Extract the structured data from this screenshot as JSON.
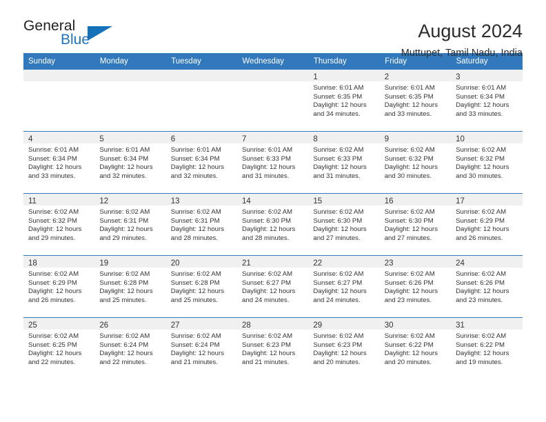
{
  "brand": {
    "name_top": "General",
    "name_bottom": "Blue",
    "accent_color": "#1572b9",
    "triangle_icon": "triangle-icon"
  },
  "header": {
    "month_title": "August 2024",
    "location": "Muttupet, Tamil Nadu, India"
  },
  "calendar": {
    "header_bg": "#3179bc",
    "daynum_band_bg": "#f0f0f0",
    "weekdays": [
      "Sunday",
      "Monday",
      "Tuesday",
      "Wednesday",
      "Thursday",
      "Friday",
      "Saturday"
    ],
    "weeks": [
      [
        {
          "day": "",
          "lines": []
        },
        {
          "day": "",
          "lines": []
        },
        {
          "day": "",
          "lines": []
        },
        {
          "day": "",
          "lines": []
        },
        {
          "day": "1",
          "lines": [
            "Sunrise: 6:01 AM",
            "Sunset: 6:35 PM",
            "Daylight: 12 hours",
            "and 34 minutes."
          ]
        },
        {
          "day": "2",
          "lines": [
            "Sunrise: 6:01 AM",
            "Sunset: 6:35 PM",
            "Daylight: 12 hours",
            "and 33 minutes."
          ]
        },
        {
          "day": "3",
          "lines": [
            "Sunrise: 6:01 AM",
            "Sunset: 6:34 PM",
            "Daylight: 12 hours",
            "and 33 minutes."
          ]
        }
      ],
      [
        {
          "day": "4",
          "lines": [
            "Sunrise: 6:01 AM",
            "Sunset: 6:34 PM",
            "Daylight: 12 hours",
            "and 33 minutes."
          ]
        },
        {
          "day": "5",
          "lines": [
            "Sunrise: 6:01 AM",
            "Sunset: 6:34 PM",
            "Daylight: 12 hours",
            "and 32 minutes."
          ]
        },
        {
          "day": "6",
          "lines": [
            "Sunrise: 6:01 AM",
            "Sunset: 6:34 PM",
            "Daylight: 12 hours",
            "and 32 minutes."
          ]
        },
        {
          "day": "7",
          "lines": [
            "Sunrise: 6:01 AM",
            "Sunset: 6:33 PM",
            "Daylight: 12 hours",
            "and 31 minutes."
          ]
        },
        {
          "day": "8",
          "lines": [
            "Sunrise: 6:02 AM",
            "Sunset: 6:33 PM",
            "Daylight: 12 hours",
            "and 31 minutes."
          ]
        },
        {
          "day": "9",
          "lines": [
            "Sunrise: 6:02 AM",
            "Sunset: 6:32 PM",
            "Daylight: 12 hours",
            "and 30 minutes."
          ]
        },
        {
          "day": "10",
          "lines": [
            "Sunrise: 6:02 AM",
            "Sunset: 6:32 PM",
            "Daylight: 12 hours",
            "and 30 minutes."
          ]
        }
      ],
      [
        {
          "day": "11",
          "lines": [
            "Sunrise: 6:02 AM",
            "Sunset: 6:32 PM",
            "Daylight: 12 hours",
            "and 29 minutes."
          ]
        },
        {
          "day": "12",
          "lines": [
            "Sunrise: 6:02 AM",
            "Sunset: 6:31 PM",
            "Daylight: 12 hours",
            "and 29 minutes."
          ]
        },
        {
          "day": "13",
          "lines": [
            "Sunrise: 6:02 AM",
            "Sunset: 6:31 PM",
            "Daylight: 12 hours",
            "and 28 minutes."
          ]
        },
        {
          "day": "14",
          "lines": [
            "Sunrise: 6:02 AM",
            "Sunset: 6:30 PM",
            "Daylight: 12 hours",
            "and 28 minutes."
          ]
        },
        {
          "day": "15",
          "lines": [
            "Sunrise: 6:02 AM",
            "Sunset: 6:30 PM",
            "Daylight: 12 hours",
            "and 27 minutes."
          ]
        },
        {
          "day": "16",
          "lines": [
            "Sunrise: 6:02 AM",
            "Sunset: 6:30 PM",
            "Daylight: 12 hours",
            "and 27 minutes."
          ]
        },
        {
          "day": "17",
          "lines": [
            "Sunrise: 6:02 AM",
            "Sunset: 6:29 PM",
            "Daylight: 12 hours",
            "and 26 minutes."
          ]
        }
      ],
      [
        {
          "day": "18",
          "lines": [
            "Sunrise: 6:02 AM",
            "Sunset: 6:29 PM",
            "Daylight: 12 hours",
            "and 26 minutes."
          ]
        },
        {
          "day": "19",
          "lines": [
            "Sunrise: 6:02 AM",
            "Sunset: 6:28 PM",
            "Daylight: 12 hours",
            "and 25 minutes."
          ]
        },
        {
          "day": "20",
          "lines": [
            "Sunrise: 6:02 AM",
            "Sunset: 6:28 PM",
            "Daylight: 12 hours",
            "and 25 minutes."
          ]
        },
        {
          "day": "21",
          "lines": [
            "Sunrise: 6:02 AM",
            "Sunset: 6:27 PM",
            "Daylight: 12 hours",
            "and 24 minutes."
          ]
        },
        {
          "day": "22",
          "lines": [
            "Sunrise: 6:02 AM",
            "Sunset: 6:27 PM",
            "Daylight: 12 hours",
            "and 24 minutes."
          ]
        },
        {
          "day": "23",
          "lines": [
            "Sunrise: 6:02 AM",
            "Sunset: 6:26 PM",
            "Daylight: 12 hours",
            "and 23 minutes."
          ]
        },
        {
          "day": "24",
          "lines": [
            "Sunrise: 6:02 AM",
            "Sunset: 6:26 PM",
            "Daylight: 12 hours",
            "and 23 minutes."
          ]
        }
      ],
      [
        {
          "day": "25",
          "lines": [
            "Sunrise: 6:02 AM",
            "Sunset: 6:25 PM",
            "Daylight: 12 hours",
            "and 22 minutes."
          ]
        },
        {
          "day": "26",
          "lines": [
            "Sunrise: 6:02 AM",
            "Sunset: 6:24 PM",
            "Daylight: 12 hours",
            "and 22 minutes."
          ]
        },
        {
          "day": "27",
          "lines": [
            "Sunrise: 6:02 AM",
            "Sunset: 6:24 PM",
            "Daylight: 12 hours",
            "and 21 minutes."
          ]
        },
        {
          "day": "28",
          "lines": [
            "Sunrise: 6:02 AM",
            "Sunset: 6:23 PM",
            "Daylight: 12 hours",
            "and 21 minutes."
          ]
        },
        {
          "day": "29",
          "lines": [
            "Sunrise: 6:02 AM",
            "Sunset: 6:23 PM",
            "Daylight: 12 hours",
            "and 20 minutes."
          ]
        },
        {
          "day": "30",
          "lines": [
            "Sunrise: 6:02 AM",
            "Sunset: 6:22 PM",
            "Daylight: 12 hours",
            "and 20 minutes."
          ]
        },
        {
          "day": "31",
          "lines": [
            "Sunrise: 6:02 AM",
            "Sunset: 6:22 PM",
            "Daylight: 12 hours",
            "and 19 minutes."
          ]
        }
      ]
    ]
  }
}
